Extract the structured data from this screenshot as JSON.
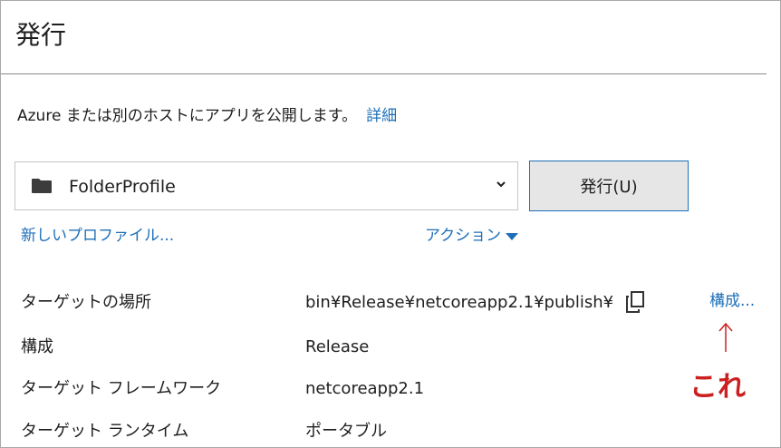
{
  "header": {
    "title": "発行"
  },
  "description": {
    "text": "Azure または別のホストにアプリを公開します。",
    "details_link": "詳細"
  },
  "profile": {
    "selected": "FolderProfile",
    "icon": "folder-icon"
  },
  "publish_button": {
    "label": "発行(U)"
  },
  "links": {
    "new_profile": "新しいプロファイル...",
    "actions": "アクション"
  },
  "properties": [
    {
      "label": "ターゲットの場所",
      "value": "bin¥Release¥netcoreapp2.1¥publish¥"
    },
    {
      "label": "構成",
      "value": "Release"
    },
    {
      "label": "ターゲット フレームワーク",
      "value": "netcoreapp2.1"
    },
    {
      "label": "ターゲット ランタイム",
      "value": "ポータブル"
    }
  ],
  "configure_link": "構成...",
  "annotation": {
    "text": "これ",
    "color": "#cc2020"
  },
  "colors": {
    "link": "#1e6fb8",
    "button_bg": "#e6e6e6",
    "button_border": "#1e6fb8"
  }
}
